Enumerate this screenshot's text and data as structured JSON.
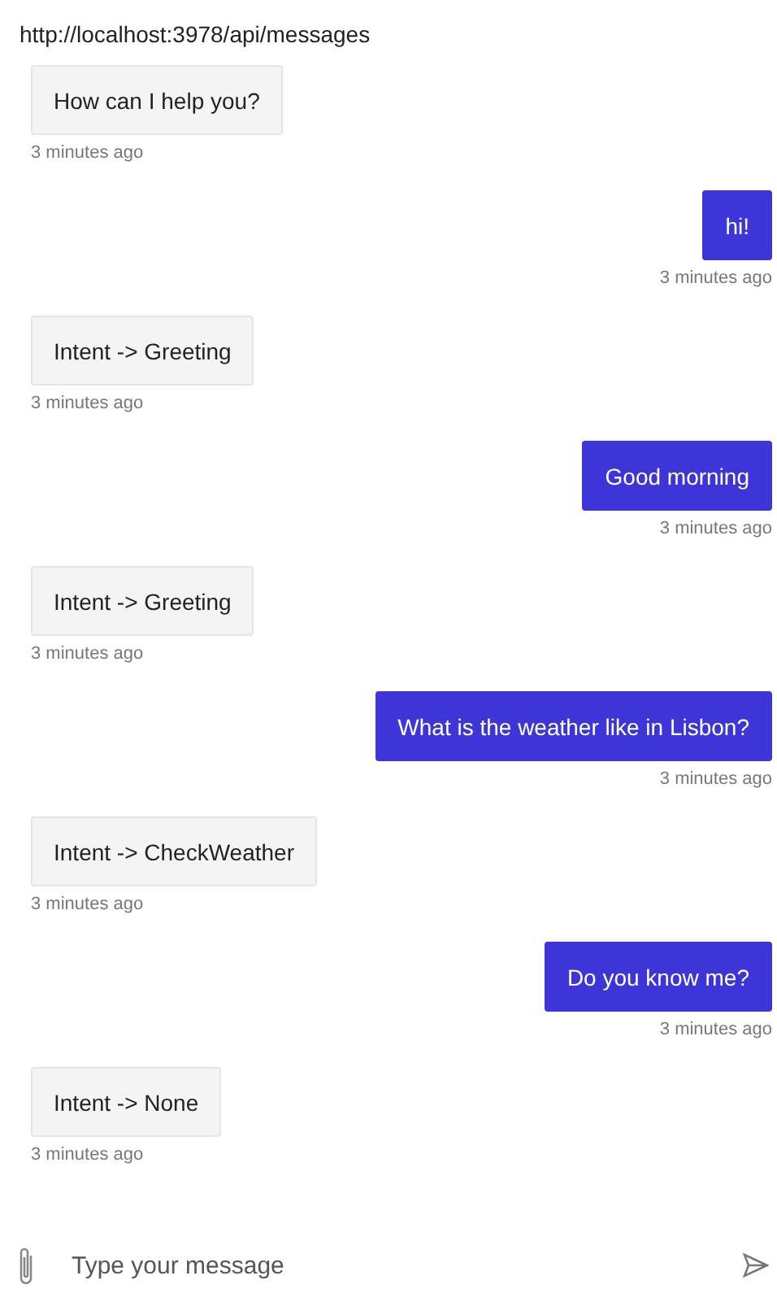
{
  "url": "http://localhost:3978/api/messages",
  "messages": [
    {
      "kind": "bot",
      "text": "How can I help you?",
      "time": "3 minutes ago"
    },
    {
      "kind": "user",
      "text": "hi!",
      "time": "3 minutes ago"
    },
    {
      "kind": "bot",
      "text": "Intent -> Greeting",
      "time": "3 minutes ago"
    },
    {
      "kind": "user",
      "text": "Good morning",
      "time": "3 minutes ago"
    },
    {
      "kind": "bot",
      "text": "Intent -> Greeting",
      "time": "3 minutes ago"
    },
    {
      "kind": "user",
      "text": "What is the weather like in Lisbon?",
      "time": "3 minutes ago"
    },
    {
      "kind": "bot",
      "text": "Intent -> CheckWeather",
      "time": "3 minutes ago"
    },
    {
      "kind": "user",
      "text": "Do you know me?",
      "time": "3 minutes ago"
    },
    {
      "kind": "bot",
      "text": "Intent -> None",
      "time": "3 minutes ago"
    }
  ],
  "input": {
    "placeholder": "Type your message"
  }
}
